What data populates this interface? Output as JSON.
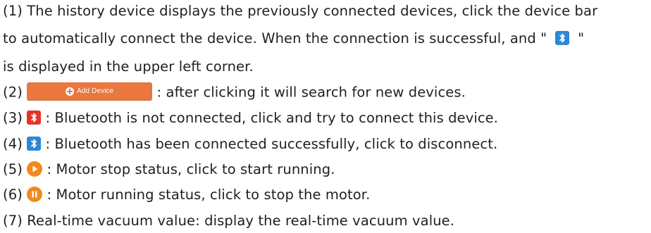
{
  "lines": {
    "l1a": "(1) The history device displays the previously connected devices, click the device bar",
    "l1b_pre": "to automatically connect the device. When the connection is successful, and \"",
    "l1b_post": "\"",
    "l1c": "is displayed in the upper left corner.",
    "l2_num": "(2)",
    "l2_text": ": after clicking it will search for new devices.",
    "l3_num": "(3)",
    "l3_text": ": Bluetooth is not connected, click and try to connect this device.",
    "l4_num": "(4)",
    "l4_text": ": Bluetooth has been  connected successfully, click to disconnect.",
    "l5_num": "(5)",
    "l5_text": ": Motor stop status, click to start running.",
    "l6_num": "(6)",
    "l6_text": ": Motor running status, click to stop the motor.",
    "l7": "(7) Real-time vacuum value: display the real-time vacuum value."
  },
  "add_button": {
    "label": "Add Device",
    "icon": "plus-circle-icon"
  },
  "icons": {
    "bluetooth_connected": "bluetooth-icon",
    "bluetooth_disconnected": "bluetooth-icon",
    "play": "play-icon",
    "pause": "pause-icon"
  },
  "colors": {
    "bluetooth_blue": "#2e86d6",
    "bluetooth_red": "#e5332a",
    "motor_orange": "#f08a1c",
    "add_button_orange": "#e9773e",
    "text": "#1f1f1f"
  }
}
